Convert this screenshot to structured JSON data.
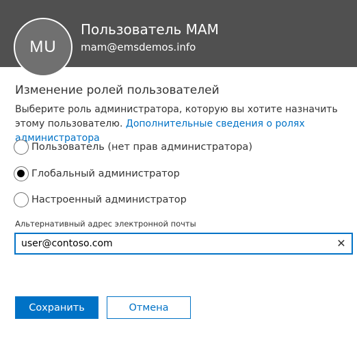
{
  "header": {
    "avatar_initials": "MU",
    "user_name": "Пользователь MAM",
    "user_email": "mam@emsdemos.info"
  },
  "section": {
    "title": "Изменение ролей пользователей",
    "description": "Выберите роль администратора, которую вы хотите назначить этому пользователю.",
    "link_text": "Дополнительные сведения о ролях администратора"
  },
  "roles": [
    {
      "label": "Пользователь (нет прав администратора)",
      "checked": false
    },
    {
      "label": "Глобальный администратор",
      "checked": true
    },
    {
      "label": "Настроенный администратор",
      "checked": false
    }
  ],
  "alt_email": {
    "label": "Альтернативный адрес электронной почты",
    "value": "user@contoso.com",
    "clear_symbol": "✕"
  },
  "buttons": {
    "save_label": "Сохранить",
    "cancel_label": "Отмена"
  },
  "colors": {
    "header_bg": "#505050",
    "accent": "#0072c6"
  }
}
